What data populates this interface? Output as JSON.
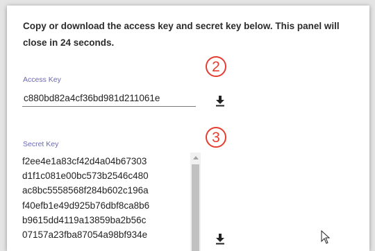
{
  "panel": {
    "instructions": "Copy or download the access key and secret key below. This panel will close in 24 seconds."
  },
  "access_key": {
    "label": "Access Key",
    "value": "c880bd82a4cf36bd981d211061e"
  },
  "secret_key": {
    "label": "Secret Key",
    "lines": [
      "f2ee4e1a83cf42d4a04b67303",
      "d1f1c081e00bc573b2546c480",
      "ac8bc5558568f284b602c196a",
      "f40efb1e49d925b76dbf8ca8b6",
      "b9615dd4119a13859ba2b56c",
      "07157a23fba87054a98bf934e"
    ]
  },
  "annotations": {
    "access": "2",
    "secret": "3"
  },
  "icons": {
    "download": "download-icon",
    "scroll_up": "chevron-up-icon",
    "cursor": "mouse-pointer-icon"
  },
  "colors": {
    "label": "#6b67b4",
    "annotation": "#e53d2f",
    "text": "#2b2b2b"
  }
}
